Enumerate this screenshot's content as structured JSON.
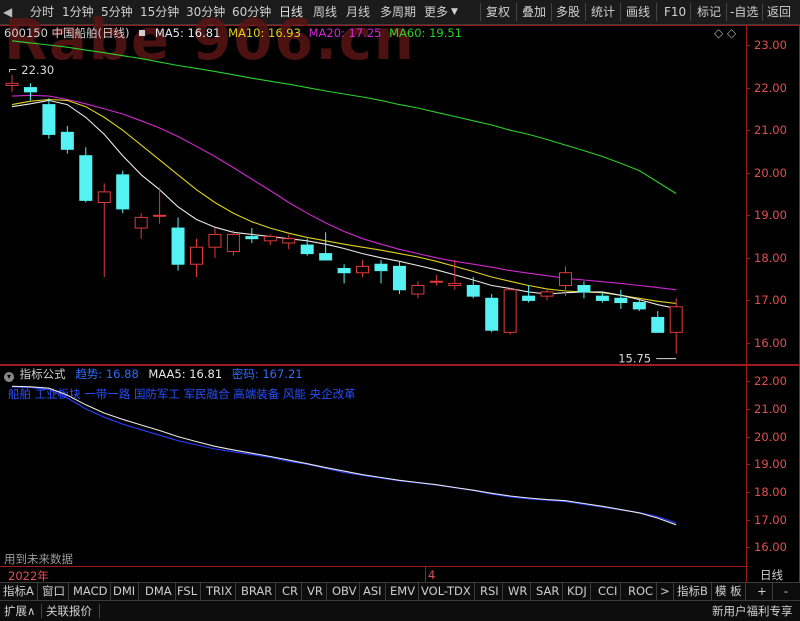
{
  "toolbar": {
    "periods": [
      "分时",
      "1分钟",
      "5分钟",
      "15分钟",
      "30分钟",
      "60分钟",
      "日线",
      "周线",
      "月线",
      "多周期",
      "更多"
    ],
    "selected": "日线",
    "more_arrow": "▼",
    "left_arrow": "◀",
    "right_items": [
      "复权",
      "叠加",
      "多股",
      "统计",
      "画线",
      "F10",
      "标记",
      "-自选",
      "返回"
    ]
  },
  "watermark": "Rabe  906.cn",
  "main_chart": {
    "code_name": "600150 中国船舶(日线)",
    "ma_items": [
      {
        "label": "MA5: 16.81",
        "color": "#e8e8e8"
      },
      {
        "label": "MA10: 16.93",
        "color": "#e0d21c"
      },
      {
        "label": "MA20: 17.25",
        "color": "#d028d0"
      },
      {
        "label": "MA60: 19.51",
        "color": "#2ad12a"
      }
    ],
    "y_labels": [
      "23.00",
      "22.00",
      "21.00",
      "20.00",
      "19.00",
      "18.00",
      "17.00",
      "16.00"
    ],
    "high_label": "22.30",
    "low_label": "15.75",
    "diamond_icons": "◇  ◇"
  },
  "chart_data": {
    "type": "candlestick",
    "ylim": [
      15.6,
      23.4
    ],
    "candles": [
      {
        "o": 22.05,
        "h": 22.3,
        "l": 21.9,
        "c": 22.1
      },
      {
        "o": 22.0,
        "h": 22.1,
        "l": 21.7,
        "c": 21.9
      },
      {
        "o": 21.6,
        "h": 21.75,
        "l": 20.8,
        "c": 20.9
      },
      {
        "o": 20.95,
        "h": 21.1,
        "l": 20.45,
        "c": 20.55
      },
      {
        "o": 20.4,
        "h": 20.6,
        "l": 19.3,
        "c": 19.35
      },
      {
        "o": 19.3,
        "h": 19.75,
        "l": 17.55,
        "c": 19.55
      },
      {
        "o": 19.95,
        "h": 20.05,
        "l": 19.05,
        "c": 19.15
      },
      {
        "o": 18.7,
        "h": 19.05,
        "l": 18.45,
        "c": 18.95
      },
      {
        "o": 19.0,
        "h": 19.65,
        "l": 18.8,
        "c": 19.0
      },
      {
        "o": 18.7,
        "h": 18.95,
        "l": 17.7,
        "c": 17.85
      },
      {
        "o": 17.85,
        "h": 18.45,
        "l": 17.55,
        "c": 18.25
      },
      {
        "o": 18.25,
        "h": 18.7,
        "l": 18.0,
        "c": 18.55
      },
      {
        "o": 18.15,
        "h": 18.65,
        "l": 18.05,
        "c": 18.55
      },
      {
        "o": 18.5,
        "h": 18.7,
        "l": 18.35,
        "c": 18.45
      },
      {
        "o": 18.4,
        "h": 18.55,
        "l": 18.3,
        "c": 18.5
      },
      {
        "o": 18.35,
        "h": 18.55,
        "l": 18.2,
        "c": 18.45
      },
      {
        "o": 18.3,
        "h": 18.45,
        "l": 18.05,
        "c": 18.1
      },
      {
        "o": 18.1,
        "h": 18.6,
        "l": 17.95,
        "c": 17.95
      },
      {
        "o": 17.75,
        "h": 17.85,
        "l": 17.4,
        "c": 17.65
      },
      {
        "o": 17.65,
        "h": 17.95,
        "l": 17.55,
        "c": 17.8
      },
      {
        "o": 17.85,
        "h": 17.95,
        "l": 17.4,
        "c": 17.7
      },
      {
        "o": 17.8,
        "h": 17.9,
        "l": 17.15,
        "c": 17.25
      },
      {
        "o": 17.15,
        "h": 17.45,
        "l": 17.05,
        "c": 17.35
      },
      {
        "o": 17.45,
        "h": 17.6,
        "l": 17.35,
        "c": 17.45
      },
      {
        "o": 17.35,
        "h": 17.95,
        "l": 17.25,
        "c": 17.4
      },
      {
        "o": 17.35,
        "h": 17.55,
        "l": 17.05,
        "c": 17.1
      },
      {
        "o": 17.05,
        "h": 17.15,
        "l": 16.25,
        "c": 16.3
      },
      {
        "o": 16.25,
        "h": 17.3,
        "l": 16.2,
        "c": 17.25
      },
      {
        "o": 17.1,
        "h": 17.35,
        "l": 16.95,
        "c": 17.0
      },
      {
        "o": 17.1,
        "h": 17.25,
        "l": 17.0,
        "c": 17.2
      },
      {
        "o": 17.35,
        "h": 17.8,
        "l": 17.1,
        "c": 17.65
      },
      {
        "o": 17.35,
        "h": 17.45,
        "l": 17.05,
        "c": 17.2
      },
      {
        "o": 17.1,
        "h": 17.2,
        "l": 16.95,
        "c": 17.0
      },
      {
        "o": 17.05,
        "h": 17.25,
        "l": 16.8,
        "c": 16.95
      },
      {
        "o": 16.95,
        "h": 17.05,
        "l": 16.75,
        "c": 16.8
      },
      {
        "o": 16.6,
        "h": 16.75,
        "l": 16.25,
        "c": 16.25
      },
      {
        "o": 16.25,
        "h": 17.05,
        "l": 15.75,
        "c": 16.85
      }
    ],
    "ma5": [
      21.55,
      21.62,
      21.7,
      21.6,
      21.3,
      20.9,
      20.4,
      19.95,
      19.6,
      19.2,
      18.9,
      18.72,
      18.6,
      18.55,
      18.5,
      18.45,
      18.4,
      18.32,
      18.22,
      18.1,
      18.0,
      17.92,
      17.82,
      17.72,
      17.6,
      17.48,
      17.35,
      17.28,
      17.2,
      17.15,
      17.18,
      17.2,
      17.2,
      17.12,
      17.02,
      16.9,
      16.81
    ],
    "ma10": [
      21.6,
      21.68,
      21.72,
      21.7,
      21.55,
      21.3,
      21.0,
      20.65,
      20.3,
      19.95,
      19.6,
      19.3,
      19.05,
      18.85,
      18.7,
      18.58,
      18.48,
      18.4,
      18.32,
      18.25,
      18.18,
      18.1,
      18.02,
      17.92,
      17.8,
      17.68,
      17.55,
      17.45,
      17.35,
      17.27,
      17.22,
      17.2,
      17.18,
      17.12,
      17.05,
      16.98,
      16.93
    ],
    "ma20": [
      21.8,
      21.82,
      21.8,
      21.72,
      21.62,
      21.5,
      21.38,
      21.22,
      21.05,
      20.85,
      20.62,
      20.38,
      20.12,
      19.85,
      19.58,
      19.3,
      19.05,
      18.82,
      18.62,
      18.45,
      18.32,
      18.2,
      18.1,
      18.0,
      17.92,
      17.85,
      17.78,
      17.7,
      17.64,
      17.58,
      17.52,
      17.48,
      17.44,
      17.4,
      17.35,
      17.3,
      17.25
    ],
    "ma60": [
      23.1,
      23.05,
      23.0,
      22.95,
      22.88,
      22.82,
      22.75,
      22.68,
      22.6,
      22.52,
      22.45,
      22.38,
      22.3,
      22.22,
      22.15,
      22.08,
      22.0,
      21.92,
      21.85,
      21.78,
      21.7,
      21.6,
      21.52,
      21.42,
      21.32,
      21.22,
      21.12,
      21.0,
      20.9,
      20.78,
      20.65,
      20.52,
      20.38,
      20.22,
      20.05,
      19.78,
      19.51
    ],
    "indicator": {
      "ylim": [
        15.5,
        22.3
      ],
      "trend": [
        21.8,
        21.78,
        21.7,
        21.4,
        21.0,
        20.7,
        20.45,
        20.25,
        20.05,
        19.85,
        19.7,
        19.55,
        19.45,
        19.35,
        19.25,
        19.1,
        19.0,
        18.85,
        18.7,
        18.6,
        18.5,
        18.4,
        18.32,
        18.25,
        18.15,
        18.05,
        17.92,
        17.82,
        17.75,
        17.7,
        17.65,
        17.55,
        17.45,
        17.35,
        17.25,
        17.1,
        16.88
      ],
      "maa5": [
        21.82,
        21.8,
        21.75,
        21.5,
        21.15,
        20.85,
        20.62,
        20.42,
        20.22,
        20.0,
        19.82,
        19.65,
        19.52,
        19.4,
        19.28,
        19.15,
        19.02,
        18.88,
        18.75,
        18.62,
        18.52,
        18.42,
        18.34,
        18.26,
        18.16,
        18.06,
        17.95,
        17.85,
        17.78,
        17.72,
        17.68,
        17.58,
        17.48,
        17.36,
        17.24,
        17.05,
        16.81
      ]
    }
  },
  "indicator_panel": {
    "title": "指标公式",
    "items": [
      {
        "label": "趋势: 16.88",
        "color": "#2e6bff"
      },
      {
        "label": "MAA5: 16.81",
        "color": "#e8e8e8"
      },
      {
        "label": "密码: 167.21",
        "color": "#2e6bff"
      }
    ],
    "concept_text": "船舶 工业板块 一带一路 国防军工 军民融合 高端装备 风能 央企改革",
    "future_text": "用到未来数据",
    "y_labels": [
      "22.00",
      "21.00",
      "20.00",
      "19.00",
      "18.00",
      "17.00",
      "16.00"
    ],
    "date_left": "2022年",
    "date_mid": "4",
    "period_label": "日线"
  },
  "tabs": [
    "指标A",
    "窗口",
    "MACD",
    "DMI",
    "DMA",
    "FSL",
    "TRIX",
    "BRAR",
    "CR",
    "VR",
    "OBV",
    "ASI",
    "EMV",
    "VOL-TDX",
    "RSI",
    "WR",
    "SAR",
    "KDJ",
    "CCI",
    "ROC",
    ">",
    "指标B",
    "模 板",
    "+",
    "-"
  ],
  "status": {
    "left": [
      "扩展∧",
      "关联报价"
    ],
    "right": "新用户福利专享"
  },
  "colors": {
    "up": "#e03a3a",
    "down": "#54f2f2",
    "frame": "#9e1b1b",
    "axis_text": "#e05050"
  }
}
